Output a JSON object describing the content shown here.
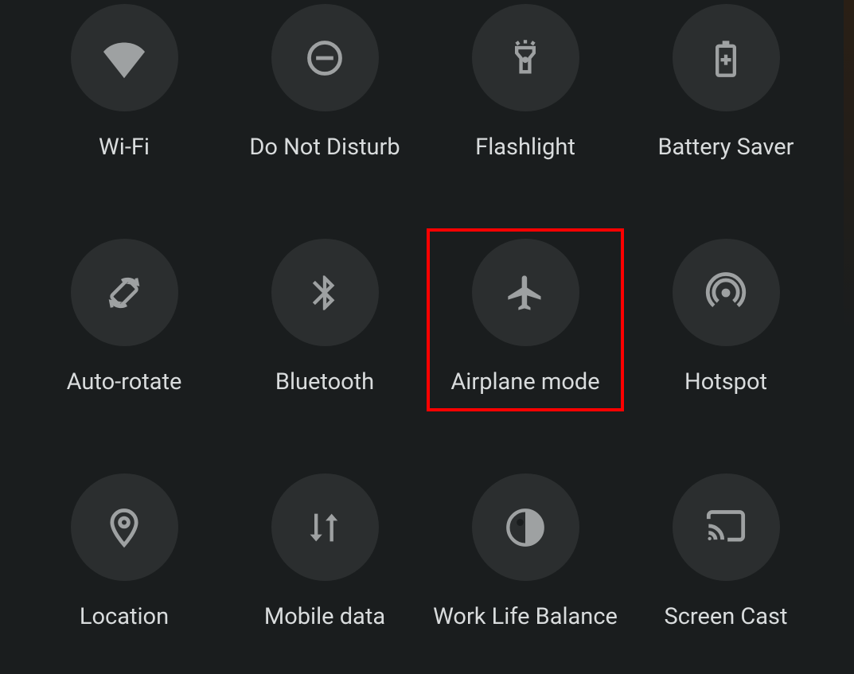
{
  "tiles": [
    {
      "id": "wifi",
      "label": "Wi-Fi",
      "icon": "wifi-icon"
    },
    {
      "id": "dnd",
      "label": "Do Not Disturb",
      "icon": "dnd-icon"
    },
    {
      "id": "flashlight",
      "label": "Flashlight",
      "icon": "flashlight-icon"
    },
    {
      "id": "battery-saver",
      "label": "Battery Saver",
      "icon": "battery-saver-icon"
    },
    {
      "id": "auto-rotate",
      "label": "Auto-rotate",
      "icon": "auto-rotate-icon"
    },
    {
      "id": "bluetooth",
      "label": "Bluetooth",
      "icon": "bluetooth-icon"
    },
    {
      "id": "airplane-mode",
      "label": "Airplane mode",
      "icon": "airplane-icon",
      "highlighted": true
    },
    {
      "id": "hotspot",
      "label": "Hotspot",
      "icon": "hotspot-icon"
    },
    {
      "id": "location",
      "label": "Location",
      "icon": "location-icon"
    },
    {
      "id": "mobile-data",
      "label": "Mobile data",
      "icon": "mobile-data-icon"
    },
    {
      "id": "work-life-balance",
      "label": "Work Life Balance",
      "icon": "work-life-balance-icon"
    },
    {
      "id": "screen-cast",
      "label": "Screen Cast",
      "icon": "screen-cast-icon"
    }
  ],
  "colors": {
    "background": "#1a1d1e",
    "tile_circle": "#2b2e2f",
    "icon": "#9ea1a2",
    "text": "#d9dcdd",
    "highlight_border": "#ff0000"
  }
}
